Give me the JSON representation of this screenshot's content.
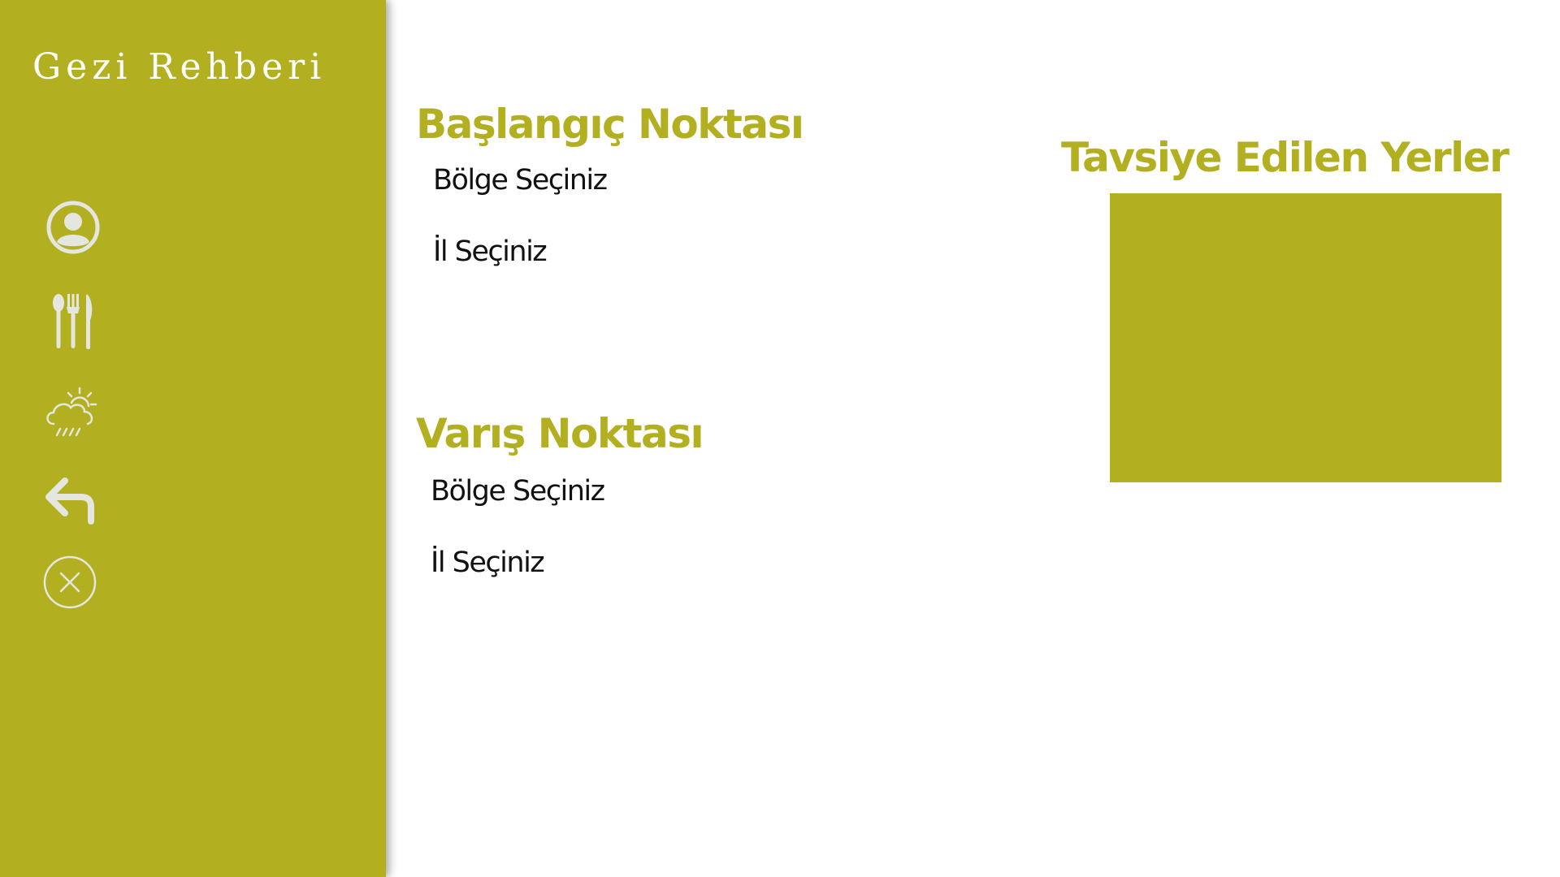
{
  "app": {
    "title": "Gezi Rehberi"
  },
  "colors": {
    "accent": "#b2b021",
    "sidebar_icon": "#e6e6e0",
    "text": "#111111",
    "background": "#ffffff"
  },
  "sidebar": {
    "icons": [
      {
        "name": "user-profile-icon"
      },
      {
        "name": "restaurant-icon"
      },
      {
        "name": "weather-icon"
      },
      {
        "name": "back-arrow-icon"
      },
      {
        "name": "close-icon"
      }
    ]
  },
  "start": {
    "heading": "Başlangıç Noktası",
    "region_select": "Bölge Seçiniz",
    "city_select": "İl Seçiniz"
  },
  "destination": {
    "heading": "Varış Noktası",
    "region_select": "Bölge Seçiniz",
    "city_select": "İl Seçiniz"
  },
  "recommendations": {
    "heading": "Tavsiye Edilen Yerler"
  }
}
